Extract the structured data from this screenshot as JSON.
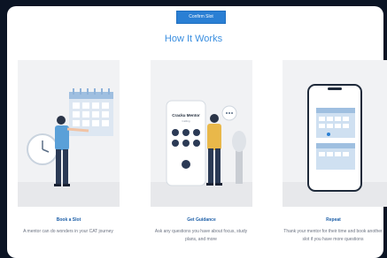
{
  "confirm_button": {
    "label": "Confirm Slot"
  },
  "section": {
    "title": "How It Works"
  },
  "steps": [
    {
      "title": "Book a Slot",
      "description": "A mentor can do wonders in your CAT journey"
    },
    {
      "title": "Get Guidance",
      "description": "Ask any questions you have about focus, study plans, and more"
    },
    {
      "title": "Repeat",
      "description": "Thank your mentor for their time and book another slot if you have more questions"
    }
  ],
  "phone": {
    "name": "Cracku Mentor",
    "status": "Calling"
  },
  "colors": {
    "accent": "#2a7fd4",
    "title": "#3b8fe0",
    "step_title": "#1d5fa8",
    "illustration_bg": "#f1f2f4"
  }
}
